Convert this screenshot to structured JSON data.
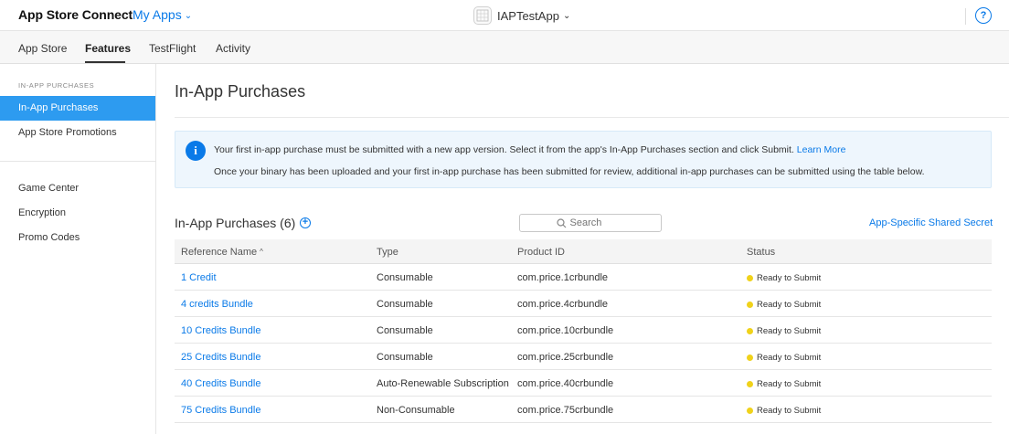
{
  "header": {
    "brand": "App Store Connect",
    "my_apps": "My Apps",
    "app_name": "IAPTestApp",
    "help": "?"
  },
  "tabs": [
    {
      "label": "App Store"
    },
    {
      "label": "Features"
    },
    {
      "label": "TestFlight"
    },
    {
      "label": "Activity"
    }
  ],
  "sidebar": {
    "heading": "IN-APP PURCHASES",
    "items": [
      {
        "label": "In-App Purchases"
      },
      {
        "label": "App Store Promotions"
      },
      {
        "label": "Game Center"
      },
      {
        "label": "Encryption"
      },
      {
        "label": "Promo Codes"
      }
    ]
  },
  "main": {
    "title": "In-App Purchases",
    "info": {
      "line1": "Your first in-app purchase must be submitted with a new app version. Select it from the app's In-App Purchases section and click Submit.",
      "learn_more": "Learn More",
      "line2": "Once your binary has been uploaded and your first in-app purchase has been submitted for review, additional in-app purchases can be submitted using the table below."
    },
    "section_title": "In-App Purchases (6)",
    "search_placeholder": "Search",
    "shared_secret": "App-Specific Shared Secret",
    "columns": {
      "name": "Reference Name",
      "type": "Type",
      "product_id": "Product ID",
      "status": "Status"
    },
    "rows": [
      {
        "name": "1 Credit",
        "type": "Consumable",
        "product_id": "com.price.1crbundle",
        "status": "Ready to Submit"
      },
      {
        "name": "4 credits Bundle",
        "type": "Consumable",
        "product_id": "com.price.4crbundle",
        "status": "Ready to Submit"
      },
      {
        "name": "10 Credits Bundle",
        "type": "Consumable",
        "product_id": "com.price.10crbundle",
        "status": "Ready to Submit"
      },
      {
        "name": "25 Credits Bundle",
        "type": "Consumable",
        "product_id": "com.price.25crbundle",
        "status": "Ready to Submit"
      },
      {
        "name": "40 Credits Bundle",
        "type": "Auto-Renewable Subscription",
        "product_id": "com.price.40crbundle",
        "status": "Ready to Submit"
      },
      {
        "name": "75 Credits Bundle",
        "type": "Non-Consumable",
        "product_id": "com.price.75crbundle",
        "status": "Ready to Submit"
      }
    ]
  },
  "colors": {
    "accent": "#0a7ae8",
    "sidebar_active": "#2d9bf0",
    "status_dot": "#f0d21a"
  }
}
